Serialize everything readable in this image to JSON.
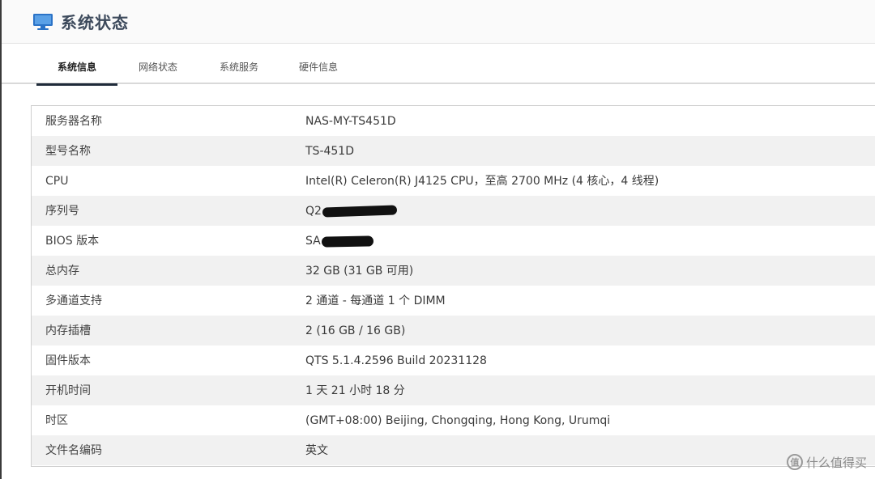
{
  "header": {
    "title": "系统状态",
    "icon": "monitor-icon"
  },
  "tabs": [
    {
      "label": "系统信息",
      "active": true
    },
    {
      "label": "网络状态",
      "active": false
    },
    {
      "label": "系统服务",
      "active": false
    },
    {
      "label": "硬件信息",
      "active": false
    }
  ],
  "system_info": {
    "rows": [
      {
        "label": "服务器名称",
        "value": "NAS-MY-TS451D"
      },
      {
        "label": "型号名称",
        "value": "TS-451D"
      },
      {
        "label": "CPU",
        "value": "Intel(R) Celeron(R) J4125 CPU，至高 2700 MHz (4 核心，4 线程)"
      },
      {
        "label": "序列号",
        "value": "Q2"
      },
      {
        "label": "BIOS 版本",
        "value": "SA"
      },
      {
        "label": "总内存",
        "value": "32 GB (31 GB 可用)"
      },
      {
        "label": "多通道支持",
        "value": "2 通道 - 每通道 1 个 DIMM"
      },
      {
        "label": "内存插槽",
        "value": "2 (16 GB / 16 GB)"
      },
      {
        "label": "固件版本",
        "value": "QTS 5.1.4.2596 Build 20231128"
      },
      {
        "label": "开机时间",
        "value": "1 天 21 小时 18 分"
      },
      {
        "label": "时区",
        "value": "(GMT+08:00) Beijing, Chongqing, Hong Kong, Urumqi"
      },
      {
        "label": "文件名编码",
        "value": "英文"
      }
    ]
  },
  "watermark": {
    "icon_text": "值",
    "text": "什么值得买"
  },
  "colors": {
    "title": "#3d4a5c",
    "active_tab_underline": "#1f2b3a",
    "stripe": "#f1f1f1",
    "monitor_icon": "#2b73c7"
  }
}
